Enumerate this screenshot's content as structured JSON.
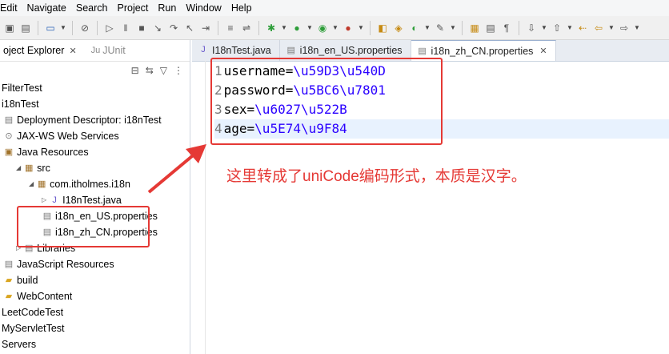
{
  "menu": [
    "Edit",
    "Navigate",
    "Search",
    "Project",
    "Run",
    "Window",
    "Help"
  ],
  "toolbar_icons": [
    "save-icon",
    "save-all-icon",
    "console-icon",
    "skip-breakpoints-icon",
    "resume-icon",
    "suspend-icon",
    "terminate-icon",
    "step-into-icon",
    "step-over-icon",
    "step-return-icon",
    "drop-frame-icon",
    "debug-icon",
    "run-icon",
    "coverage-icon",
    "external-tools-icon",
    "new-java-project-icon",
    "new-package-icon",
    "new-class-icon",
    "open-type-icon",
    "search-icon",
    "annotation-icon",
    "pilcrow-icon",
    "next-annotation-icon",
    "prev-annotation-icon",
    "back-icon",
    "forward-icon"
  ],
  "left_panel": {
    "tab_explorer": "oject Explorer",
    "tab_junit": "JUnit",
    "tree": [
      {
        "label": "FilterTest",
        "icon": "project-icon",
        "indent": 0
      },
      {
        "label": "i18nTest",
        "icon": "project-icon",
        "indent": 0
      },
      {
        "label": "Deployment Descriptor: i18nTest",
        "icon": "descriptor-icon",
        "indent": 1
      },
      {
        "label": "JAX-WS Web Services",
        "icon": "webservices-icon",
        "indent": 1
      },
      {
        "label": "Java Resources",
        "icon": "java-resources-icon",
        "indent": 1
      },
      {
        "label": "src",
        "icon": "src-folder-icon",
        "indent": 2,
        "arrow": "expanded"
      },
      {
        "label": "com.itholmes.i18n",
        "icon": "package-icon",
        "indent": 3,
        "arrow": "expanded"
      },
      {
        "label": "I18nTest.java",
        "icon": "java-file-icon",
        "indent": 4,
        "arrow": "collapsed"
      },
      {
        "label": "i18n_en_US.properties",
        "icon": "properties-file-icon",
        "indent": 4
      },
      {
        "label": "i18n_zh_CN.properties",
        "icon": "properties-file-icon",
        "indent": 4
      },
      {
        "label": "Libraries",
        "icon": "libraries-icon",
        "indent": 2,
        "arrow": "collapsed"
      },
      {
        "label": "JavaScript Resources",
        "icon": "js-resources-icon",
        "indent": 1
      },
      {
        "label": "build",
        "icon": "folder-icon",
        "indent": 1
      },
      {
        "label": "WebContent",
        "icon": "folder-icon",
        "indent": 1
      },
      {
        "label": "LeetCodeTest",
        "icon": "project-icon",
        "indent": 0
      },
      {
        "label": "MyServletTest",
        "icon": "project-icon",
        "indent": 0
      },
      {
        "label": "Servers",
        "icon": "project-icon",
        "indent": 0
      }
    ]
  },
  "editor": {
    "tabs": [
      {
        "label": "I18nTest.java",
        "icon": "java-file-icon",
        "active": false
      },
      {
        "label": "i18n_en_US.properties",
        "icon": "properties-file-icon",
        "active": false
      },
      {
        "label": "i18n_zh_CN.properties",
        "icon": "properties-file-icon",
        "active": true
      }
    ],
    "lines": [
      {
        "num": "1",
        "key": "username=",
        "value": "\\u59D3\\u540D"
      },
      {
        "num": "2",
        "key": "password=",
        "value": "\\u5BC6\\u7801"
      },
      {
        "num": "3",
        "key": "sex=",
        "value": "\\u6027\\u522B"
      },
      {
        "num": "4",
        "key": "age=",
        "value": "\\u5E74\\u9F84"
      }
    ]
  },
  "annotation": {
    "text": "这里转成了uniCode编码形式，本质是汉字。",
    "color": "#e53935"
  }
}
